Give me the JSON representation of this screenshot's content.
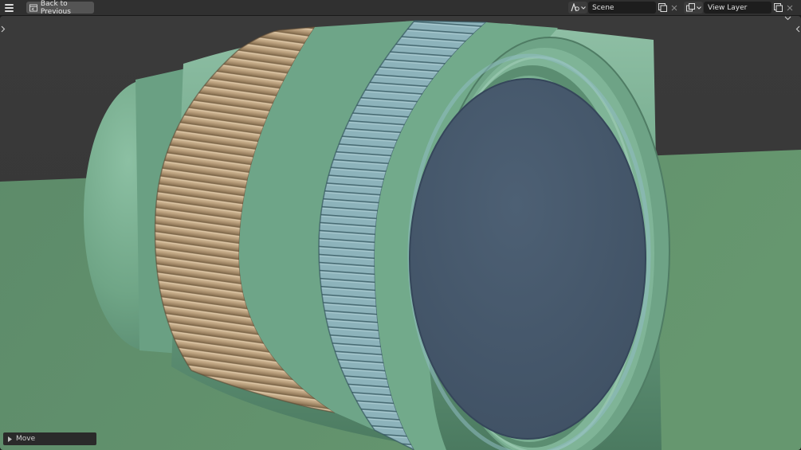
{
  "topbar": {
    "back_label": "Back to Previous",
    "scene_name": "Scene",
    "view_layer_name": "View Layer"
  },
  "icons": {
    "menu": "hamburger-menu-icon",
    "back": "screen-back-icon",
    "scene_browse": "scene-icon",
    "scene_new": "duplicate-icon",
    "scene_delete": "close-icon",
    "layer_browse": "render-layers-icon",
    "layer_new": "duplicate-icon",
    "layer_delete": "close-icon",
    "viewport_tool_expand": "chevron-right-icon",
    "viewport_sidebar_expand": "chevron-left-icon",
    "header_collapse": "chevron-down-icon"
  },
  "operator_panel": {
    "label": "Move"
  },
  "colors": {
    "lens_green": "#73a88c",
    "focus_ring": "#c9b08d",
    "aperture_ring": "#8fb5bd",
    "glass": "#44566a",
    "ground": "#5e8e6c",
    "sky": "#393939"
  }
}
